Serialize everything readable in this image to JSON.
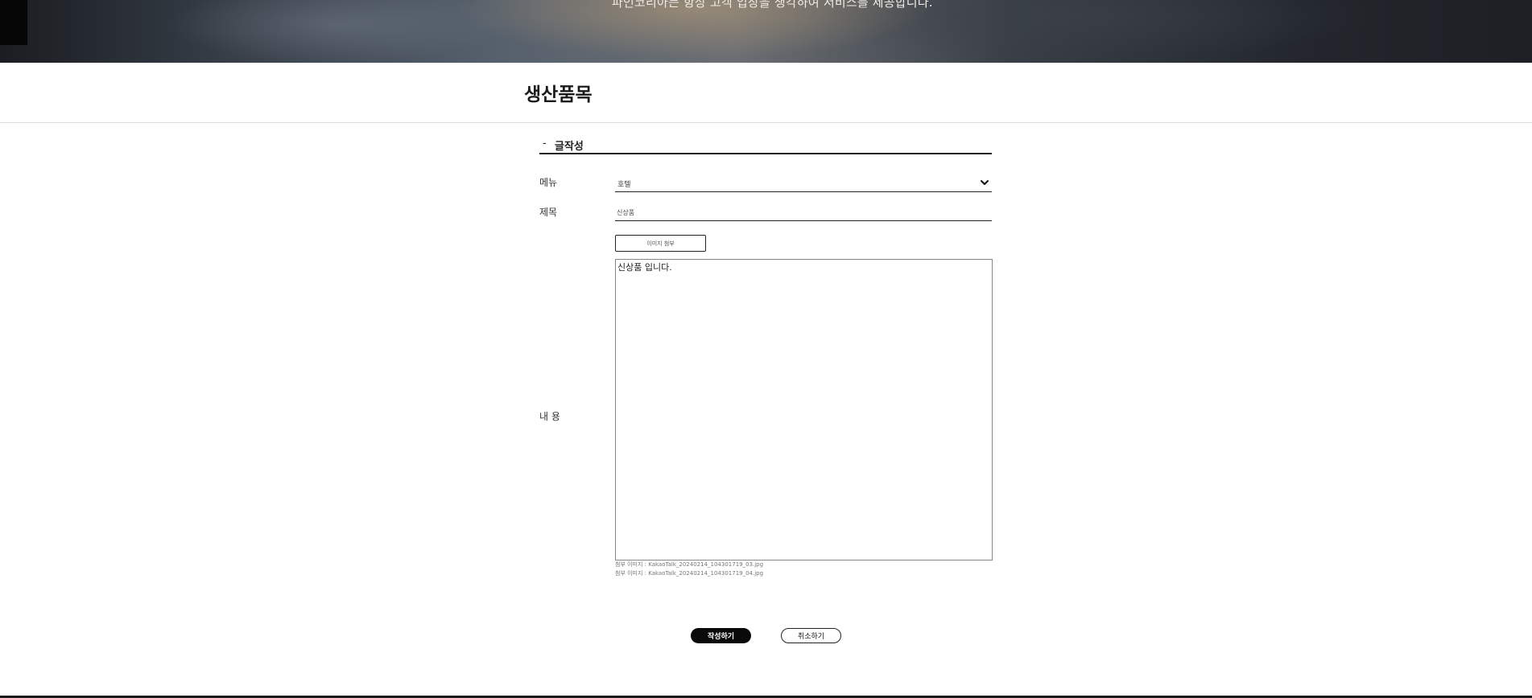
{
  "banner": {
    "text": "파인코리아는 항상 고객 입장을 생각하여 서비스를 제공합니다."
  },
  "page": {
    "title": "생산품목"
  },
  "form": {
    "section_dash": "-",
    "section_title": "글작성",
    "menu_label": "메뉴",
    "menu_value": "호텔",
    "title_label": "제목",
    "title_value": "신상품",
    "attach_label": "이미지 첨부",
    "content_label": "내 용",
    "content_value": "신상품 입니다.",
    "attached_files": [
      "첨부 이미지 : KakaoTalk_20240214_104301719_03.jpg",
      "첨부 이미지 : KakaoTalk_20240214_104301719_04.jpg"
    ]
  },
  "actions": {
    "submit_label": "작성하기",
    "cancel_label": "취소하기"
  },
  "colors": {
    "accent": "#0a0a0a",
    "background": "#ffffff"
  },
  "icons": {
    "select_arrow": "chevron-down-icon"
  }
}
